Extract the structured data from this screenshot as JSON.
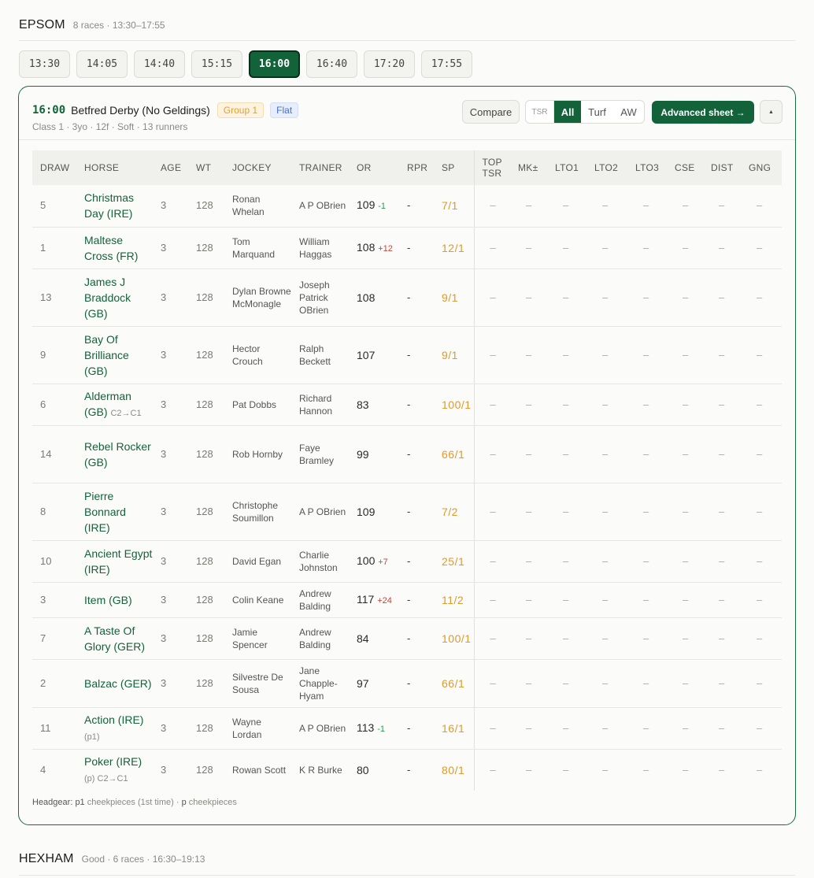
{
  "meeting": {
    "name": "EPSOM",
    "meta": "8 races · 13:30–17:55"
  },
  "times": [
    "13:30",
    "14:05",
    "14:40",
    "15:15",
    "16:00",
    "16:40",
    "17:20",
    "17:55"
  ],
  "active_time": "16:00",
  "race": {
    "time": "16:00",
    "name": "Betfred Derby (No Geldings)",
    "badge_group": "Group 1",
    "badge_flat": "Flat",
    "sub": "Class 1 · 3yo · 12f · Soft · 13 runners",
    "compare_label": "Compare",
    "filter": {
      "tsr": "TSR",
      "all": "All",
      "turf": "Turf",
      "aw": "AW"
    },
    "advanced_label": "Advanced sheet →",
    "collapse_icon": "▲"
  },
  "columns": [
    "DRAW",
    "HORSE",
    "AGE",
    "WT",
    "JOCKEY",
    "TRAINER",
    "OR",
    "RPR",
    "SP",
    "TOP TSR",
    "MK±",
    "LTO1",
    "LTO2",
    "LTO3",
    "CSE",
    "DIST",
    "GNG"
  ],
  "runners": [
    {
      "draw": "5",
      "horse": "Christmas Day (IRE)",
      "note": "",
      "age": "3",
      "wt": "128",
      "jockey": "Ronan Whelan",
      "trainer": "A P OBrien",
      "or": "109",
      "or_delta": "-1",
      "rpr": "-",
      "sp": "7/1"
    },
    {
      "draw": "1",
      "horse": "Maltese Cross (FR)",
      "note": "",
      "age": "3",
      "wt": "128",
      "jockey": "Tom Marquand",
      "trainer": "William Haggas",
      "or": "108",
      "or_delta": "+12",
      "rpr": "-",
      "sp": "12/1"
    },
    {
      "draw": "13",
      "horse": "James J Braddock (GB)",
      "note": "",
      "age": "3",
      "wt": "128",
      "jockey": "Dylan Browne McMonagle",
      "trainer": "Joseph Patrick OBrien",
      "or": "108",
      "or_delta": "",
      "rpr": "-",
      "sp": "9/1"
    },
    {
      "draw": "9",
      "horse": "Bay Of Brilliance (GB)",
      "note": "",
      "age": "3",
      "wt": "128",
      "jockey": "Hector Crouch",
      "trainer": "Ralph Beckett",
      "or": "107",
      "or_delta": "",
      "rpr": "-",
      "sp": "9/1"
    },
    {
      "draw": "6",
      "horse": "Alderman (GB)",
      "note": "C2→C1",
      "age": "3",
      "wt": "128",
      "jockey": "Pat Dobbs",
      "trainer": "Richard Hannon",
      "or": "83",
      "or_delta": "",
      "rpr": "-",
      "sp": "100/1"
    },
    {
      "draw": "14",
      "horse": "Rebel Rocker (GB)",
      "note": "",
      "age": "3",
      "wt": "128",
      "jockey": "Rob Hornby",
      "trainer": "Faye Bramley",
      "or": "99",
      "or_delta": "",
      "rpr": "-",
      "sp": "66/1"
    },
    {
      "draw": "8",
      "horse": "Pierre Bonnard (IRE)",
      "note": "",
      "age": "3",
      "wt": "128",
      "jockey": "Christophe Soumillon",
      "trainer": "A P OBrien",
      "or": "109",
      "or_delta": "",
      "rpr": "-",
      "sp": "7/2"
    },
    {
      "draw": "10",
      "horse": "Ancient Egypt (IRE)",
      "note": "",
      "age": "3",
      "wt": "128",
      "jockey": "David Egan",
      "trainer": "Charlie Johnston",
      "or": "100",
      "or_delta": "+7",
      "rpr": "-",
      "sp": "25/1"
    },
    {
      "draw": "3",
      "horse": "Item (GB)",
      "note": "",
      "age": "3",
      "wt": "128",
      "jockey": "Colin Keane",
      "trainer": "Andrew Balding",
      "or": "117",
      "or_delta": "+24",
      "rpr": "-",
      "sp": "11/2"
    },
    {
      "draw": "7",
      "horse": "A Taste Of Glory (GER)",
      "note": "",
      "age": "3",
      "wt": "128",
      "jockey": "Jamie Spencer",
      "trainer": "Andrew Balding",
      "or": "84",
      "or_delta": "",
      "rpr": "-",
      "sp": "100/1"
    },
    {
      "draw": "2",
      "horse": "Balzac (GER)",
      "note": "",
      "age": "3",
      "wt": "128",
      "jockey": "Silvestre De Sousa",
      "trainer": "Jane Chapple-Hyam",
      "or": "97",
      "or_delta": "",
      "rpr": "-",
      "sp": "66/1"
    },
    {
      "draw": "11",
      "horse": "Action (IRE)",
      "note": "(p1)",
      "age": "3",
      "wt": "128",
      "jockey": "Wayne Lordan",
      "trainer": "A P OBrien",
      "or": "113",
      "or_delta": "-1",
      "rpr": "-",
      "sp": "16/1"
    },
    {
      "draw": "4",
      "horse": "Poker (IRE)",
      "note": "(p) C2→C1",
      "age": "3",
      "wt": "128",
      "jockey": "Rowan Scott",
      "trainer": "K R Burke",
      "or": "80",
      "or_delta": "",
      "rpr": "-",
      "sp": "80/1"
    }
  ],
  "empty_cell": "–",
  "footnote": {
    "label": "Headgear:",
    "p1": "p1",
    "p1_text": "cheekpieces (1st time) ·",
    "p": "p",
    "p_text": "cheekpieces"
  },
  "meeting2": {
    "name": "HEXHAM",
    "meta": "Good · 6 races · 16:30–19:13"
  },
  "colors": {
    "brand": "#12633a",
    "sp": "#e09a2d",
    "delta_up": "#d0403a",
    "delta_down": "#2a9d55"
  }
}
